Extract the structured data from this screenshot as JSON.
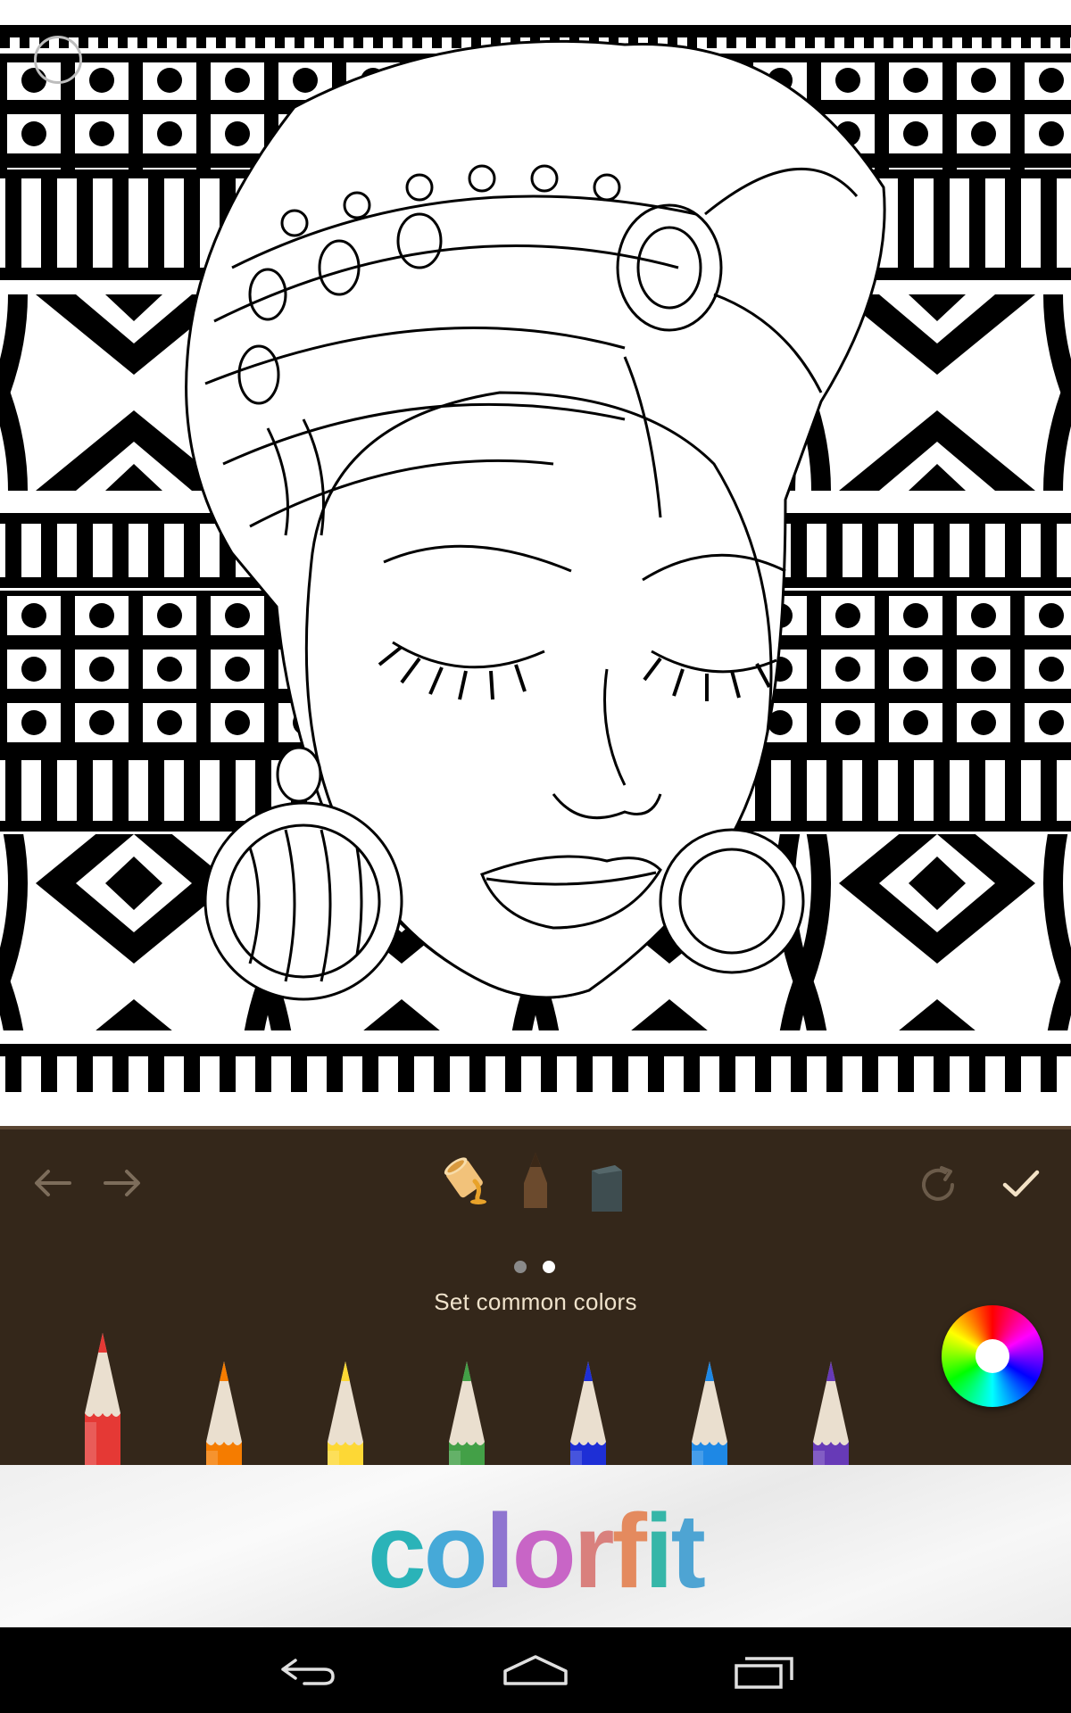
{
  "toolbar": {
    "undo_icon": "arrow-left-icon",
    "redo_icon": "arrow-right-icon",
    "tools": [
      {
        "name": "fill-bucket",
        "icon": "paint-bucket-icon",
        "selected": true
      },
      {
        "name": "pencil",
        "icon": "pencil-tool-icon",
        "selected": false
      },
      {
        "name": "eraser",
        "icon": "eraser-icon",
        "selected": false
      }
    ],
    "reset_icon": "refresh-icon",
    "done_icon": "checkmark-icon",
    "page_dots": {
      "count": 2,
      "active": 2
    },
    "hint": "Set common colors",
    "color_wheel_icon": "color-wheel-icon"
  },
  "palette": {
    "selected_index": 0,
    "pencils": [
      {
        "name": "red",
        "color": "#e53935"
      },
      {
        "name": "orange",
        "color": "#f57c00"
      },
      {
        "name": "yellow",
        "color": "#fdd835"
      },
      {
        "name": "green",
        "color": "#43a047"
      },
      {
        "name": "blue",
        "color": "#1e2fd6"
      },
      {
        "name": "light-blue",
        "color": "#1e88e5"
      },
      {
        "name": "purple",
        "color": "#673ab7"
      }
    ]
  },
  "banner": {
    "brand": "colorfit",
    "letter_colors": [
      "#2ab3b8",
      "#46a9d8",
      "#8f75d0",
      "#c865c6",
      "#d9807d",
      "#e48a5e",
      "#36b6a8",
      "#4ea4d3"
    ]
  },
  "navbar": {
    "back_icon": "back-icon",
    "home_icon": "home-icon",
    "recents_icon": "recents-icon"
  }
}
